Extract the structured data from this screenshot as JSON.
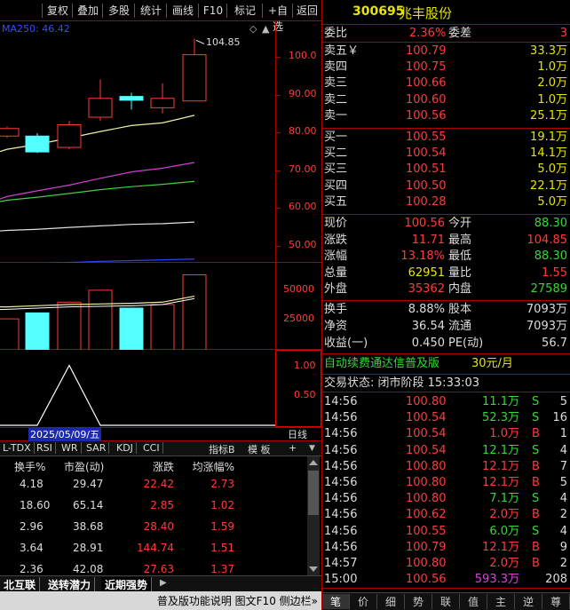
{
  "toolbar": {
    "buttons": [
      "复权",
      "叠加",
      "多股",
      "统计",
      "画线",
      "F10",
      "标记",
      "+自选",
      "返回"
    ]
  },
  "chart": {
    "ma_label": "MA250: 46.42",
    "high_annotation": "104.85",
    "price_ticks": [
      "100.0",
      "90.00",
      "80.00",
      "70.00",
      "60.00",
      "50.00"
    ],
    "volume_ticks": [
      "50000",
      "25000"
    ],
    "indicator_ticks": [
      "1.00",
      "0.50"
    ],
    "date_label": "2025/05/09/五",
    "period_label": "日线",
    "tabs": [
      "L-TDX",
      "RSI",
      "WR",
      "SAR",
      "KDJ",
      "CCI"
    ],
    "tab_controls": [
      "指标B",
      "模 板",
      "+"
    ]
  },
  "chart_data": {
    "type": "candlestick",
    "candles": [
      {
        "open": 79.0,
        "close": 81.0,
        "high": 81.5,
        "low": 78.5,
        "up": true
      },
      {
        "open": 79.0,
        "close": 74.8,
        "high": 79.8,
        "low": 74.5,
        "up": false
      },
      {
        "open": 76.0,
        "close": 82.0,
        "high": 83.0,
        "low": 75.5,
        "up": true
      },
      {
        "open": 84.0,
        "close": 89.0,
        "high": 94.0,
        "low": 83.0,
        "up": true
      },
      {
        "open": 89.5,
        "close": 88.5,
        "high": 90.5,
        "low": 86.0,
        "up": false
      },
      {
        "open": 86.5,
        "close": 89.0,
        "high": 93.0,
        "low": 85.0,
        "up": true
      },
      {
        "open": 88.3,
        "close": 100.56,
        "high": 104.85,
        "low": 88.3,
        "up": true
      }
    ],
    "ma_lines": [
      {
        "color": "#f0f0a0",
        "values": [
          75.5,
          76.8,
          78.5,
          80.2,
          81.8,
          82.5,
          84.5
        ]
      },
      {
        "color": "#d040d0",
        "values": [
          63.0,
          64.5,
          66.0,
          67.8,
          69.5,
          70.5,
          72.0
        ]
      },
      {
        "color": "#40d040",
        "values": [
          62.0,
          62.8,
          63.8,
          64.8,
          65.6,
          66.2,
          67.0
        ]
      },
      {
        "color": "#e0e0e0",
        "values": [
          54.0,
          54.3,
          54.8,
          55.2,
          55.6,
          55.8,
          56.2
        ]
      },
      {
        "color": "#3040ff",
        "values": [
          45.0,
          45.2,
          45.5,
          45.8,
          46.0,
          46.2,
          46.42
        ]
      }
    ],
    "ylim": [
      44,
      108
    ],
    "volume": [
      {
        "v": 26000,
        "up": true
      },
      {
        "v": 31000,
        "up": false
      },
      {
        "v": 40000,
        "up": true
      },
      {
        "v": 50000,
        "up": true
      },
      {
        "v": 35000,
        "up": false
      },
      {
        "v": 38000,
        "up": true
      },
      {
        "v": 62951,
        "up": true
      }
    ],
    "volume_ma": [
      36000,
      37000,
      38000,
      38500,
      39000,
      40000,
      45000
    ],
    "volume_ylim": [
      0,
      70000
    ],
    "indicator": [
      0,
      0,
      1,
      0,
      0,
      0,
      0
    ],
    "indicator_ylim": [
      0,
      1.2
    ]
  },
  "bottom_table": {
    "headers": [
      "换手%",
      "市盈(动)",
      "涨跌",
      "均涨幅%"
    ],
    "rows": [
      [
        "4.18",
        "29.47",
        "22.42",
        "2.73"
      ],
      [
        "18.60",
        "65.14",
        "2.85",
        "1.02"
      ],
      [
        "2.96",
        "38.68",
        "28.40",
        "1.59"
      ],
      [
        "3.64",
        "28.91",
        "144.74",
        "1.51"
      ],
      [
        "2.36",
        "42.08",
        "27.63",
        "1.37"
      ]
    ],
    "tabs": [
      "北互联",
      "送转潜力",
      "近期强势"
    ],
    "status": "普及版功能说明 图文F10 侧边栏»"
  },
  "quote": {
    "code": "300695",
    "name": "兆丰股份",
    "weibi_label": "委比",
    "weibi": "2.36%",
    "weicha_label": "委差",
    "weicha": "3",
    "sells": [
      {
        "label": "卖五￥",
        "price": "100.79",
        "vol": "33.3万"
      },
      {
        "label": "卖四",
        "price": "100.75",
        "vol": "1.0万"
      },
      {
        "label": "卖三",
        "price": "100.66",
        "vol": "2.0万"
      },
      {
        "label": "卖二",
        "price": "100.60",
        "vol": "1.0万"
      },
      {
        "label": "卖一",
        "price": "100.56",
        "vol": "25.1万"
      }
    ],
    "buys": [
      {
        "label": "买一",
        "price": "100.55",
        "vol": "19.1万"
      },
      {
        "label": "买二",
        "price": "100.54",
        "vol": "14.1万"
      },
      {
        "label": "买三",
        "price": "100.51",
        "vol": "5.0万"
      },
      {
        "label": "买四",
        "price": "100.50",
        "vol": "22.1万"
      },
      {
        "label": "买五",
        "price": "100.28",
        "vol": "5.0万"
      }
    ],
    "stats": [
      {
        "l1": "现价",
        "v1": "100.56",
        "c1": "red",
        "l2": "今开",
        "v2": "88.30",
        "c2": "green"
      },
      {
        "l1": "涨跌",
        "v1": "11.71",
        "c1": "red",
        "l2": "最高",
        "v2": "104.85",
        "c2": "red"
      },
      {
        "l1": "涨幅",
        "v1": "13.18%",
        "c1": "red",
        "l2": "最低",
        "v2": "88.30",
        "c2": "green"
      },
      {
        "l1": "总量",
        "v1": "62951",
        "c1": "yellow",
        "l2": "量比",
        "v2": "1.55",
        "c2": "red"
      },
      {
        "l1": "外盘",
        "v1": "35362",
        "c1": "red",
        "l2": "内盘",
        "v2": "27589",
        "c2": "green"
      }
    ],
    "stats2": [
      {
        "l1": "换手",
        "v1": "8.88%",
        "l2": "股本",
        "v2": "7093万"
      },
      {
        "l1": "净资",
        "v1": "36.54",
        "l2": "流通",
        "v2": "7093万"
      },
      {
        "l1": "收益(一)",
        "v1": "0.450",
        "l2": "PE(动)",
        "v2": "56.7"
      }
    ],
    "promo_text": "自动续费通达信普及版",
    "promo_price": "30元/月",
    "trade_status": "交易状态: 闭市阶段 15:33:03",
    "ticks": [
      {
        "t": "14:56",
        "p": "100.80",
        "v": "11.1万",
        "bs": "S",
        "n": "5"
      },
      {
        "t": "14:56",
        "p": "100.54",
        "v": "52.3万",
        "bs": "S",
        "n": "16"
      },
      {
        "t": "14:56",
        "p": "100.54",
        "v": "1.0万",
        "bs": "B",
        "n": "1"
      },
      {
        "t": "14:56",
        "p": "100.54",
        "v": "12.1万",
        "bs": "S",
        "n": "4"
      },
      {
        "t": "14:56",
        "p": "100.80",
        "v": "12.1万",
        "bs": "B",
        "n": "7"
      },
      {
        "t": "14:56",
        "p": "100.80",
        "v": "12.1万",
        "bs": "B",
        "n": "5"
      },
      {
        "t": "14:56",
        "p": "100.80",
        "v": "7.1万",
        "bs": "S",
        "n": "4"
      },
      {
        "t": "14:56",
        "p": "100.62",
        "v": "2.0万",
        "bs": "B",
        "n": "2"
      },
      {
        "t": "14:56",
        "p": "100.55",
        "v": "6.0万",
        "bs": "S",
        "n": "4"
      },
      {
        "t": "14:56",
        "p": "100.79",
        "v": "12.1万",
        "bs": "B",
        "n": "9"
      },
      {
        "t": "14:57",
        "p": "100.80",
        "v": "2.0万",
        "bs": "B",
        "n": "2"
      },
      {
        "t": "15:00",
        "p": "100.56",
        "v": "593.3万",
        "bs": "",
        "n": "208"
      }
    ],
    "bottom_tabs": [
      "笔",
      "价",
      "细",
      "势",
      "联",
      "值",
      "主",
      "逆",
      "尊"
    ]
  },
  "colors": {
    "up": "#ff3b3b",
    "down": "#54ffff",
    "frame": "#a00000",
    "bg": "#000000"
  }
}
